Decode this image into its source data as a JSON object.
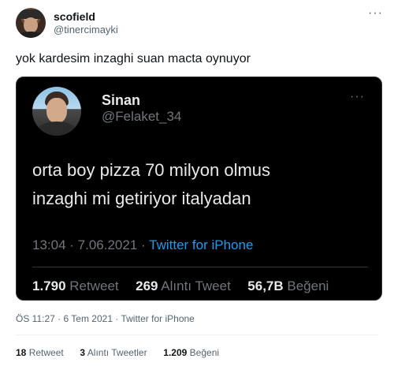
{
  "outer_tweet": {
    "author_name": "scofield",
    "author_handle": "@tinercimayki",
    "text": "yok kardesim inzaghi suan macta oynuyor",
    "time": "ÖS 11:27",
    "date": "6 Tem 2021",
    "source": "Twitter for iPhone",
    "stats": {
      "retweets_count": "18",
      "retweets_label": "Retweet",
      "quotes_count": "3",
      "quotes_label": "Alıntı Tweetler",
      "likes_count": "1.209",
      "likes_label": "Beğeni"
    }
  },
  "quoted_tweet": {
    "author_name": "Sinan",
    "author_handle": "@Felaket_34",
    "text_line1": "orta boy pizza 70 milyon olmus",
    "text_line2": "inzaghi mi getiriyor italyadan",
    "time": "13:04",
    "date": "7.06.2021",
    "source": "Twitter for iPhone",
    "stats": {
      "retweets_count": "1.790",
      "retweets_label": "Retweet",
      "quotes_count": "269",
      "quotes_label": "Alıntı Tweet",
      "likes_count": "56,7B",
      "likes_label": "Beğeni"
    }
  },
  "icons": {
    "more": "more-horizontal-icon"
  },
  "colors": {
    "link_blue": "#1d9bf0",
    "muted_gray": "#536471",
    "dark_bg": "#000000"
  }
}
